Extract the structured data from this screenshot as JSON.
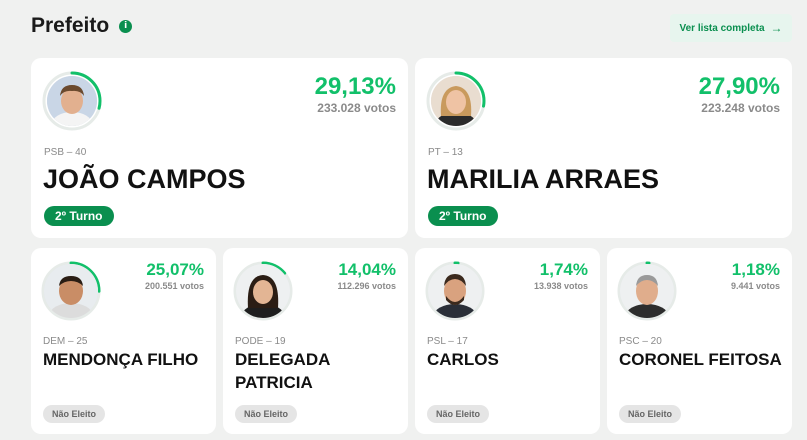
{
  "header": {
    "title": "Prefeito",
    "info_icon": "i",
    "ver_lista_label": "Ver lista completa",
    "arrow": "→"
  },
  "colors": {
    "accent": "#12c06a",
    "brand_green": "#0a8f4f",
    "badge_gray": "#e5e5e5"
  },
  "candidates": [
    {
      "pct": "29,13%",
      "votes": "233.028 votos",
      "party": "PSB – 40",
      "name": "JOÃO CAMPOS",
      "status": "2º Turno",
      "share": 0.2913
    },
    {
      "pct": "27,90%",
      "votes": "223.248 votos",
      "party": "PT – 13",
      "name": "MARILIA ARRAES",
      "status": "2º Turno",
      "share": 0.279
    },
    {
      "pct": "25,07%",
      "votes": "200.551 votos",
      "party": "DEM – 25",
      "name": "MENDONÇA FILHO",
      "status": "Não Eleito",
      "share": 0.2507
    },
    {
      "pct": "14,04%",
      "votes": "112.296 votos",
      "party": "PODE – 19",
      "name_line1": "DELEGADA",
      "name_line2": "PATRICIA",
      "status": "Não Eleito",
      "share": 0.1404
    },
    {
      "pct": "1,74%",
      "votes": "13.938 votos",
      "party": "PSL – 17",
      "name": "CARLOS",
      "status": "Não Eleito",
      "share": 0.0174
    },
    {
      "pct": "1,18%",
      "votes": "9.441 votos",
      "party": "PSC – 20",
      "name": "CORONEL FEITOSA",
      "status": "Não Eleito",
      "share": 0.0118
    }
  ]
}
